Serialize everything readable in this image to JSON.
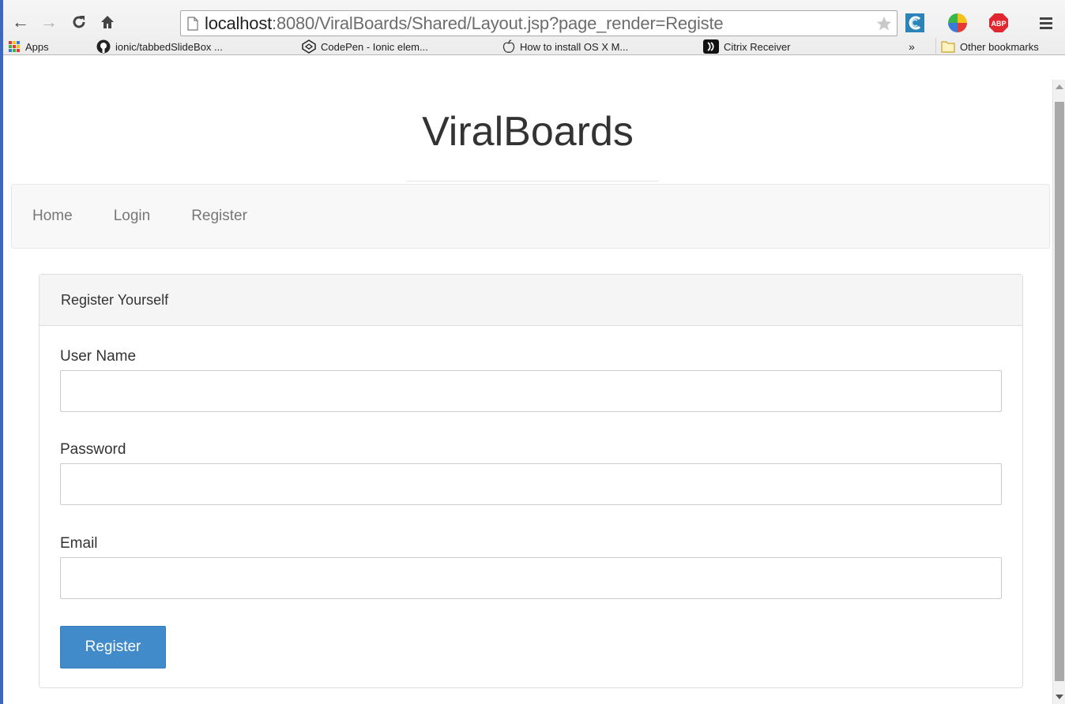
{
  "browser": {
    "url_host": "localhost",
    "url_rest": ":8080/ViralBoards/Shared/Layout.jsp?page_render=Registe",
    "bookmarks": [
      {
        "label": "Apps",
        "icon": "apps-grid-icon"
      },
      {
        "label": "ionic/tabbedSlideBox ...",
        "icon": "github-icon"
      },
      {
        "label": "CodePen - Ionic elem...",
        "icon": "codepen-icon"
      },
      {
        "label": "How to install OS X M...",
        "icon": "apple-icon"
      },
      {
        "label": "Citrix Receiver",
        "icon": "citrix-icon"
      }
    ],
    "more_bookmarks": "»",
    "other_bookmarks": "Other bookmarks"
  },
  "page": {
    "site_title": "ViralBoards",
    "nav": [
      "Home",
      "Login",
      "Register"
    ],
    "panel_title": "Register Yourself",
    "fields": [
      {
        "label": "User Name",
        "value": ""
      },
      {
        "label": "Password",
        "value": ""
      },
      {
        "label": "Email",
        "value": ""
      }
    ],
    "submit_label": "Register"
  },
  "colors": {
    "primary_button": "#428bca",
    "navbar_bg": "#f8f8f8",
    "panel_heading_bg": "#f5f5f5"
  }
}
